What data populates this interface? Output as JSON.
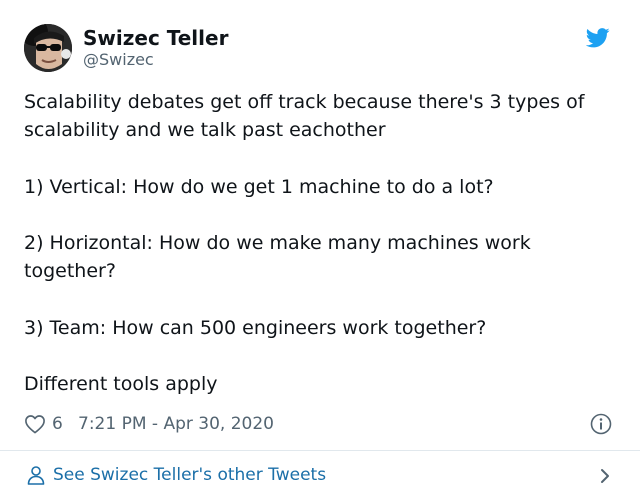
{
  "author": {
    "name": "Swizec Teller",
    "handle": "@Swizec",
    "avatar_icon": "avatar-sunglasses-icon"
  },
  "brand": {
    "icon": "twitter-bird-icon",
    "color": "#1da1f2"
  },
  "tweet": {
    "paragraphs": [
      "Scalability debates get off track because there's 3 types of scalability and we talk past eachother",
      "1) Vertical: How do we get 1 machine to do a lot?",
      "2) Horizontal: How do we make many machines work together?",
      "3) Team: How can 500 engineers work together?",
      "Different tools apply"
    ]
  },
  "meta": {
    "like_icon": "heart-icon",
    "like_count": "6",
    "timestamp": "7:21 PM - Apr 30, 2020",
    "info_icon": "info-icon"
  },
  "footer": {
    "icon": "person-icon",
    "label": "See Swizec Teller's other Tweets",
    "chevron_icon": "chevron-right-icon",
    "link_color": "#1b6fa8"
  }
}
